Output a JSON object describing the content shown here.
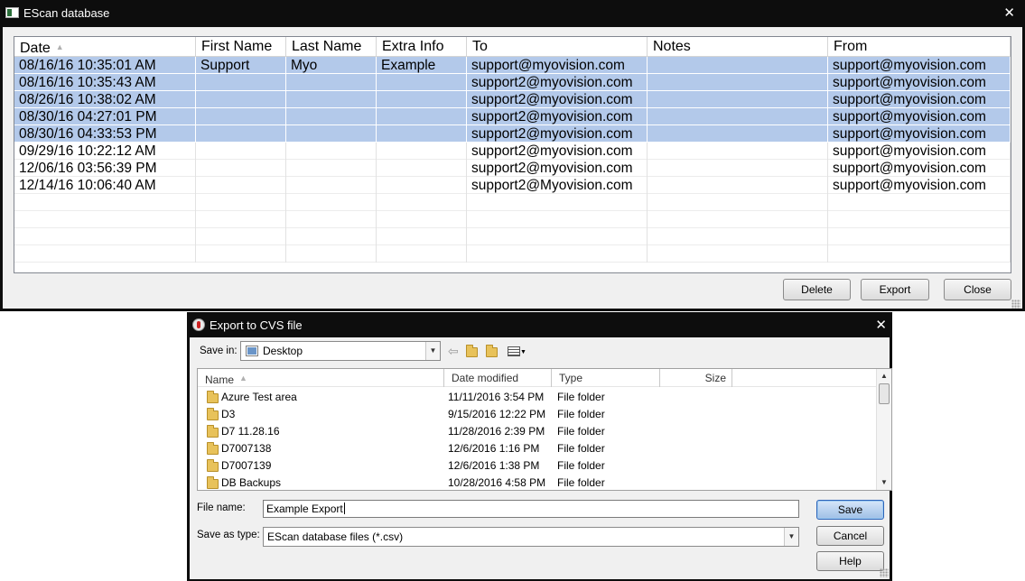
{
  "main_window": {
    "title": "EScan database",
    "close": "✕",
    "columns": [
      "Date",
      "First Name",
      "Last Name",
      "Extra Info",
      "To",
      "Notes",
      "From"
    ],
    "sort_indicator": "▲",
    "rows": [
      {
        "date": "08/16/16  10:35:01 AM",
        "first": "Support",
        "last": "Myo",
        "extra": "Example",
        "to": "support@myovision.com",
        "notes": "",
        "from": "support@myovision.com",
        "selected": true
      },
      {
        "date": "08/16/16  10:35:43 AM",
        "first": "",
        "last": "",
        "extra": "",
        "to": "support2@myovision.com",
        "notes": "",
        "from": "support@myovision.com",
        "selected": true
      },
      {
        "date": "08/26/16  10:38:02 AM",
        "first": "",
        "last": "",
        "extra": "",
        "to": "support2@myovision.com",
        "notes": "",
        "from": "support@myovision.com",
        "selected": true
      },
      {
        "date": "08/30/16  04:27:01 PM",
        "first": "",
        "last": "",
        "extra": "",
        "to": "support2@myovision.com",
        "notes": "",
        "from": "support@myovision.com",
        "selected": true
      },
      {
        "date": "08/30/16  04:33:53 PM",
        "first": "",
        "last": "",
        "extra": "",
        "to": "support2@myovision.com",
        "notes": "",
        "from": "support@myovision.com",
        "selected": true
      },
      {
        "date": "09/29/16  10:22:12 AM",
        "first": "",
        "last": "",
        "extra": "",
        "to": "support2@myovision.com",
        "notes": "",
        "from": "support@myovision.com",
        "selected": false
      },
      {
        "date": "12/06/16  03:56:39 PM",
        "first": "",
        "last": "",
        "extra": "",
        "to": "support2@myovision.com",
        "notes": "",
        "from": "support@myovision.com",
        "selected": false
      },
      {
        "date": "12/14/16  10:06:40 AM",
        "first": "",
        "last": "",
        "extra": "",
        "to": "support2@Myovision.com",
        "notes": "",
        "from": "support@myovision.com",
        "selected": false
      }
    ],
    "empty_rows": 4,
    "buttons": {
      "delete": "Delete",
      "export": "Export",
      "close": "Close"
    }
  },
  "export_dialog": {
    "title": "Export to CVS file",
    "close": "✕",
    "save_in_label": "Save in:",
    "save_in_value": "Desktop",
    "columns": [
      "Name",
      "Date modified",
      "Type",
      "Size"
    ],
    "files": [
      {
        "name": "Azure Test area",
        "modified": "11/11/2016 3:54 PM",
        "type": "File folder",
        "size": ""
      },
      {
        "name": "D3",
        "modified": "9/15/2016 12:22 PM",
        "type": "File folder",
        "size": ""
      },
      {
        "name": "D7 11.28.16",
        "modified": "11/28/2016 2:39 PM",
        "type": "File folder",
        "size": ""
      },
      {
        "name": "D7007138",
        "modified": "12/6/2016 1:16 PM",
        "type": "File folder",
        "size": ""
      },
      {
        "name": "D7007139",
        "modified": "12/6/2016 1:38 PM",
        "type": "File folder",
        "size": ""
      },
      {
        "name": "DB Backups",
        "modified": "10/28/2016 4:58 PM",
        "type": "File folder",
        "size": ""
      }
    ],
    "file_name_label": "File name:",
    "file_name_value": "Example Export",
    "save_type_label": "Save as type:",
    "save_type_value": "EScan database files (*.csv)",
    "buttons": {
      "save": "Save",
      "cancel": "Cancel",
      "help": "Help"
    }
  },
  "colors": {
    "title_bar": "#0d0d0d",
    "selection": "#b3c9ea",
    "default_button": "#9fbfe6"
  },
  "icons": [
    "app-icon",
    "close-icon",
    "back-arrow-icon",
    "up-folder-icon",
    "new-folder-icon",
    "view-menu-icon",
    "folder-icon",
    "chevron-down-icon"
  ]
}
